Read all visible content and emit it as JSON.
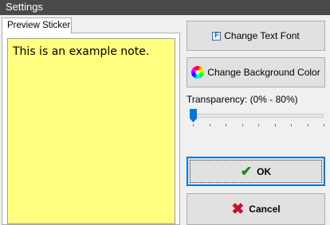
{
  "window": {
    "title": "Settings"
  },
  "tab": {
    "label": "Preview Sticker"
  },
  "preview": {
    "note_text": "This is an example note.",
    "background_color": "#ffff80"
  },
  "buttons": {
    "change_font": {
      "label": "Change Text Font",
      "icon": "font-icon"
    },
    "change_bg": {
      "label": "Change Background Color",
      "icon": "color-wheel-icon"
    },
    "ok": {
      "label": "OK",
      "icon": "check-icon"
    },
    "cancel": {
      "label": "Cancel",
      "icon": "x-icon"
    }
  },
  "transparency": {
    "label": "Transparency: (0% - 80%)",
    "value": 0
  },
  "colors": {
    "accent": "#0078d7",
    "titlebar": "#4a4a4a",
    "note": "#ffff80"
  }
}
